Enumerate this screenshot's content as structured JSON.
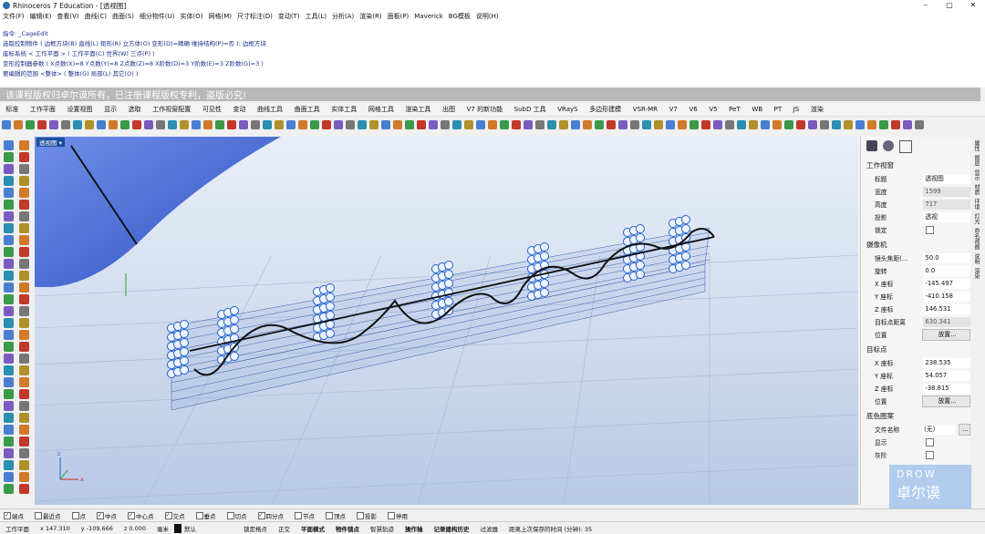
{
  "window": {
    "title": "Rhinoceros 7 Education - [透视图]",
    "controls": [
      "–",
      "□",
      "✕"
    ]
  },
  "menu": [
    "文件(F)",
    "编辑(E)",
    "查看(V)",
    "曲线(C)",
    "曲面(S)",
    "细分物件(U)",
    "实体(O)",
    "网格(M)",
    "尺寸标注(D)",
    "变动(T)",
    "工具(L)",
    "分析(A)",
    "渲染(R)",
    "面板(P)",
    "Maverick",
    "BG模板",
    "说明(H)"
  ],
  "command_history": [
    "指令: _CageEdit",
    "选取控制物件 ( 边框方块(B) 直线(L) 矩形(R) 立方体(O) 变形(D)=精确 维持结构(P)=否 ): 边框方块",
    "座标系统 < 工作平面 > ( 工作平面(C) 世界(W) 三点(P) )",
    "变形控制器参数 ( X点数(X)=8 Y点数(Y)=8 Z点数(Z)=8 X阶数(D)=3 Y阶数(E)=3 Z阶数(G)=3 )",
    "要编辑的范围 <整体> ( 整体(G) 局部(L) 其它(O) )"
  ],
  "watermark_text": "该课程版权归卓尔谟所有，已注册课程版权专利，盗版必究!",
  "tabs": [
    "标准",
    "工作平面",
    "设置视图",
    "显示",
    "选取",
    "工作视窗配置",
    "可见性",
    "变动",
    "曲线工具",
    "曲面工具",
    "实体工具",
    "网格工具",
    "渲染工具",
    "出图",
    "V7 的新功能",
    "SubD 工具",
    "VRayS",
    "多边形建模",
    "VSR-MR",
    "V7",
    "V6",
    "V5",
    "PeT",
    "WB",
    "PT",
    "JS",
    "渲染"
  ],
  "viewport": {
    "label": "透视图 ▾"
  },
  "properties": {
    "section_viewport": "工作视窗",
    "title_label": "标题",
    "title_value": "透视图",
    "width_label": "宽度",
    "width_value": "1599",
    "height_label": "高度",
    "height_value": "717",
    "projection_label": "投影",
    "projection_value": "透视",
    "lock_label": "锁定",
    "section_camera": "摄像机",
    "lens_label": "镜头焦距(...",
    "lens_value": "50.0",
    "rotate_label": "旋转",
    "rotate_value": "0.0",
    "cx_label": "X 座标",
    "cx_value": "-145.497",
    "cy_label": "Y 座标",
    "cy_value": "-410.158",
    "cz_label": "Z 座标",
    "cz_value": "146.531",
    "dist_label": "目标点距离",
    "dist_value": "630.341",
    "pos_label": "位置",
    "place_button": "放置...",
    "section_target": "目标点",
    "tx_label": "X 座标",
    "tx_value": "238.535",
    "ty_label": "Y 座标",
    "ty_value": "54.057",
    "tz_label": "Z 座标",
    "tz_value": "-38.815",
    "tpos_label": "位置",
    "tplace_button": "放置...",
    "section_wallpaper": "底色图案",
    "file_label": "文件名称",
    "file_value": "(无)",
    "browse_button": "...",
    "show_label": "显示",
    "gray_label": "灰阶"
  },
  "side_tabs": [
    "属性",
    "图层",
    "显示",
    "材质",
    "环境",
    "灯光",
    "命名视图",
    "说明",
    "渲染"
  ],
  "osnaps": [
    "端点",
    "最近点",
    "点",
    "中点",
    "中心点",
    "交点",
    "垂点",
    "切点",
    "四分点",
    "节点",
    "顶点",
    "投影",
    "停用"
  ],
  "osnaps_checked": [
    true,
    false,
    false,
    true,
    true,
    true,
    false,
    false,
    true,
    false,
    false,
    false,
    false
  ],
  "status": {
    "cplane": "工作平面",
    "x": "x 147.310",
    "y": "y -109.666",
    "z": "z 0.000",
    "unit": "毫米",
    "layer": "默认",
    "toggles": [
      "锁定格点",
      "正交",
      "平面模式",
      "物件锁点",
      "智慧轨迹",
      "操作轴",
      "记录建构历史",
      "过滤器"
    ],
    "message": "距离上次保存的时间 (分钟): 35"
  },
  "logo": {
    "line1": "DROW",
    "line2": "卓尔谟"
  }
}
